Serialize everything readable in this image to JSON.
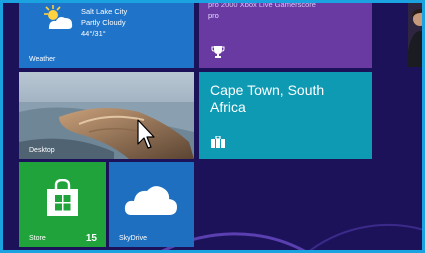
{
  "colors": {
    "background": "#1c1259",
    "border_accent": "#1aa3e0",
    "weather_tile": "#1f74c9",
    "games_tile": "#6a3aa3",
    "travel_tile": "#0f9ab4",
    "store_tile": "#1fa33a",
    "skydrive_tile": "#1f6fc0"
  },
  "tiles": {
    "weather": {
      "city": "Salt Lake City",
      "condition": "Partly Cloudy",
      "temperature": "44°/31°",
      "label": "Weather",
      "icon": "sun-cloud-icon"
    },
    "games": {
      "line1": "pro  2000 Xbox Live Gamerscore",
      "line2": "pro",
      "icon": "trophy-icon"
    },
    "desktop": {
      "label": "Desktop"
    },
    "travel": {
      "title": "Cape Town, South Africa",
      "icon": "briefcase-icon"
    },
    "store": {
      "label": "Store",
      "badge": "15",
      "icon": "shopping-bag-icon"
    },
    "skydrive": {
      "label": "SkyDrive",
      "icon": "cloud-icon"
    }
  }
}
